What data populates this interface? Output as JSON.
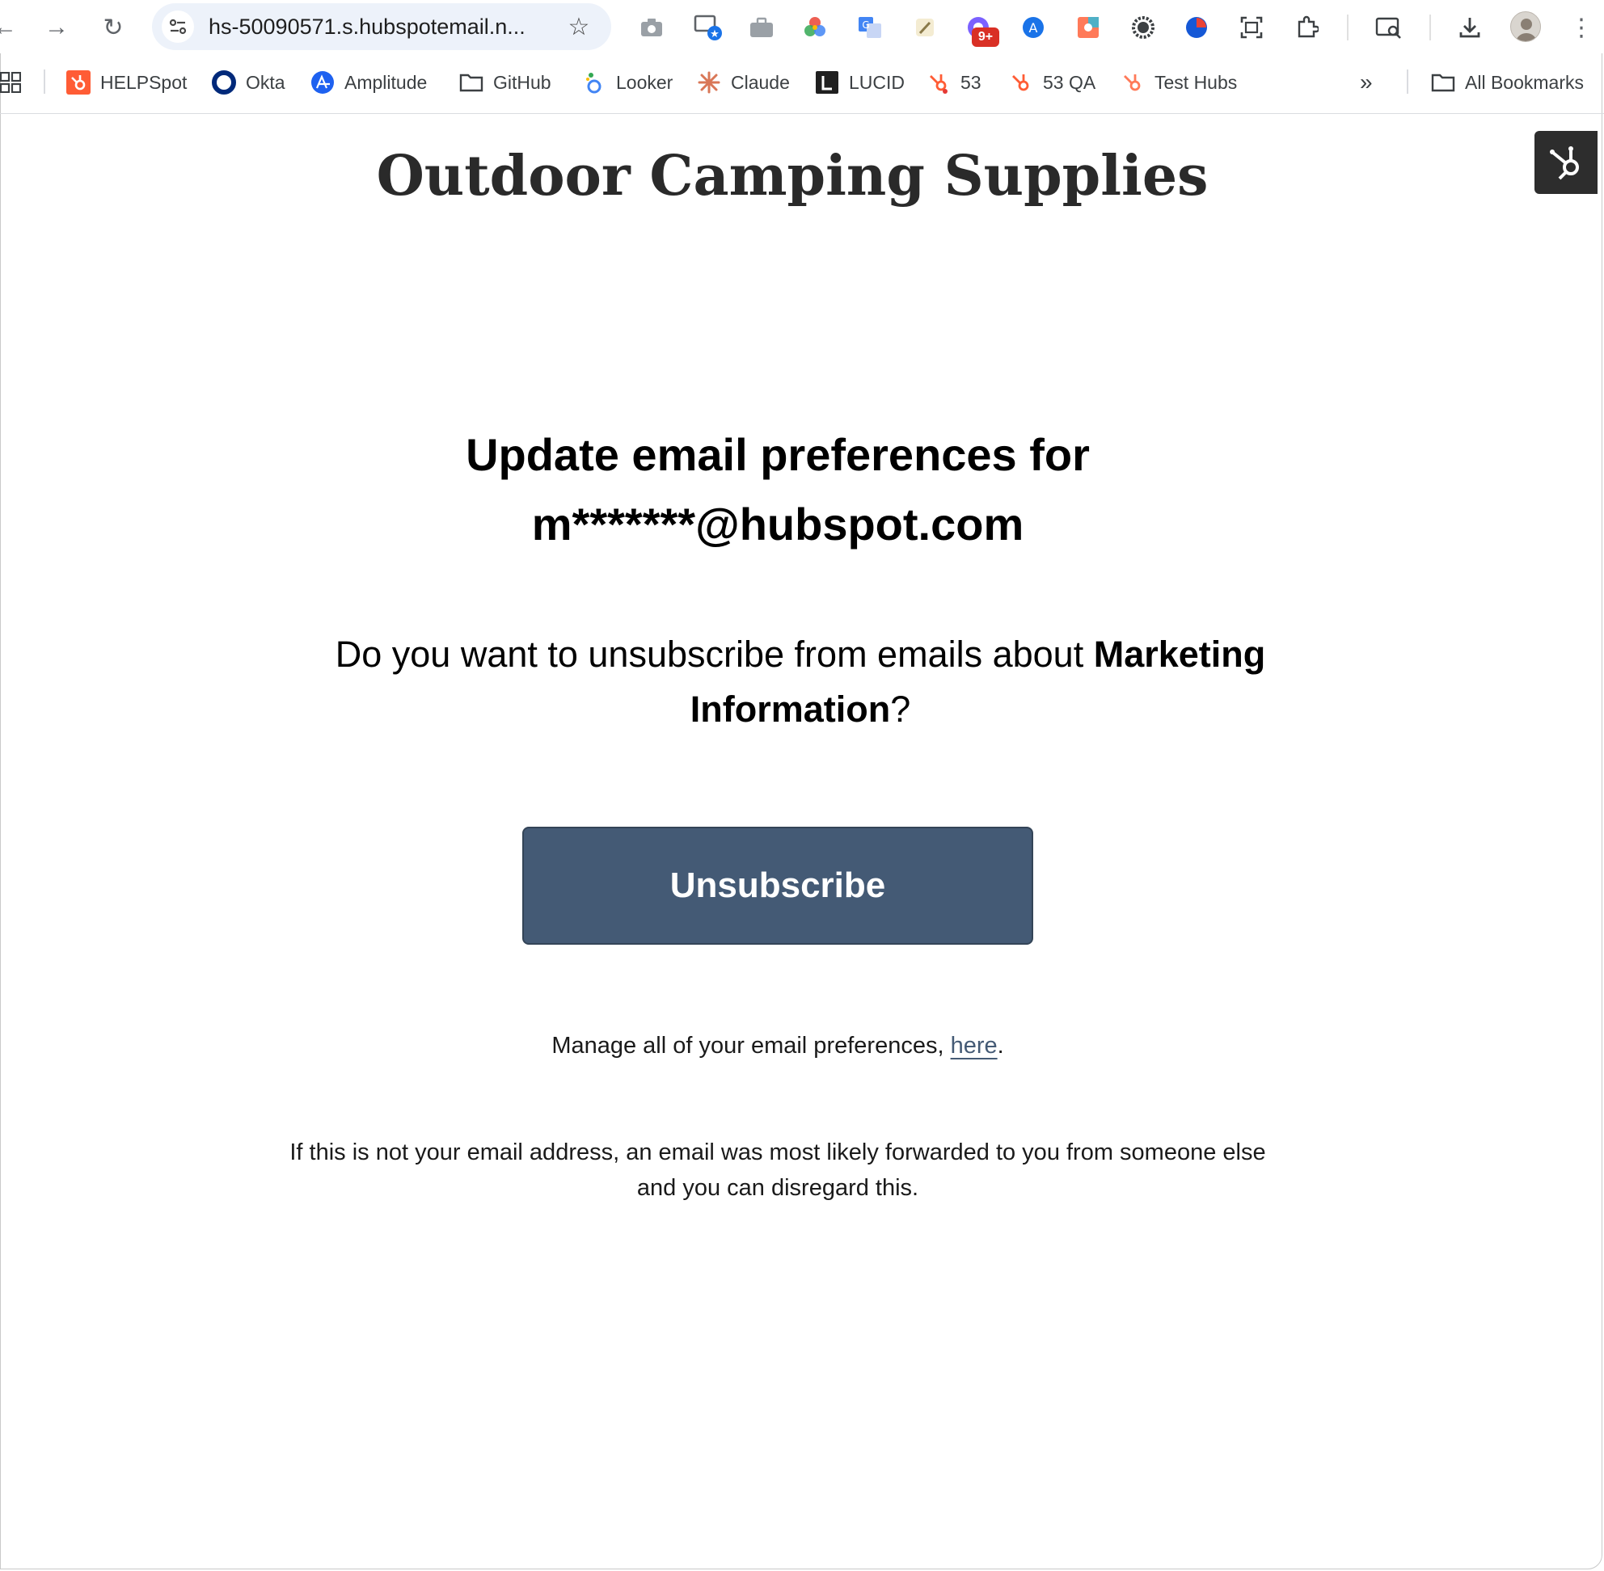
{
  "browser": {
    "url": "hs-50090571.s.hubspotemail.n...",
    "extension_badge": "9+",
    "bookmarks": [
      {
        "label": "HELPSpot",
        "icon": "hubspot-sprocket-orange-icon"
      },
      {
        "label": "Okta",
        "icon": "okta-icon"
      },
      {
        "label": "Amplitude",
        "icon": "amplitude-icon"
      },
      {
        "label": "GitHub",
        "icon": "folder-icon"
      },
      {
        "label": "Looker",
        "icon": "looker-icon"
      },
      {
        "label": "Claude",
        "icon": "claude-icon"
      },
      {
        "label": "LUCID",
        "icon": "lucid-icon"
      },
      {
        "label": "53",
        "icon": "hubspot-sprocket-icon"
      },
      {
        "label": "53 QA",
        "icon": "hubspot-sprocket-icon"
      },
      {
        "label": "Test Hubs",
        "icon": "hubspot-sprocket-icon"
      }
    ],
    "all_bookmarks": "All Bookmarks",
    "colors": {
      "accent": "#445a75",
      "omnibox": "#edf2fa",
      "hubspot": "#ff5c35"
    }
  },
  "page": {
    "brand": "Outdoor Camping Supplies",
    "heading_line1": "Update email preferences for",
    "heading_line2": "m*******@hubspot.com",
    "question_prefix": "Do you want to unsubscribe from emails about ",
    "question_subject": "Marketing Information",
    "question_suffix": "?",
    "unsubscribe_label": "Unsubscribe",
    "manage_prefix": "Manage all of your email preferences, ",
    "manage_link": "here",
    "manage_suffix": ".",
    "disclaimer": "If this is not your email address, an email was most likely forwarded to you from someone else and you can disregard this."
  }
}
